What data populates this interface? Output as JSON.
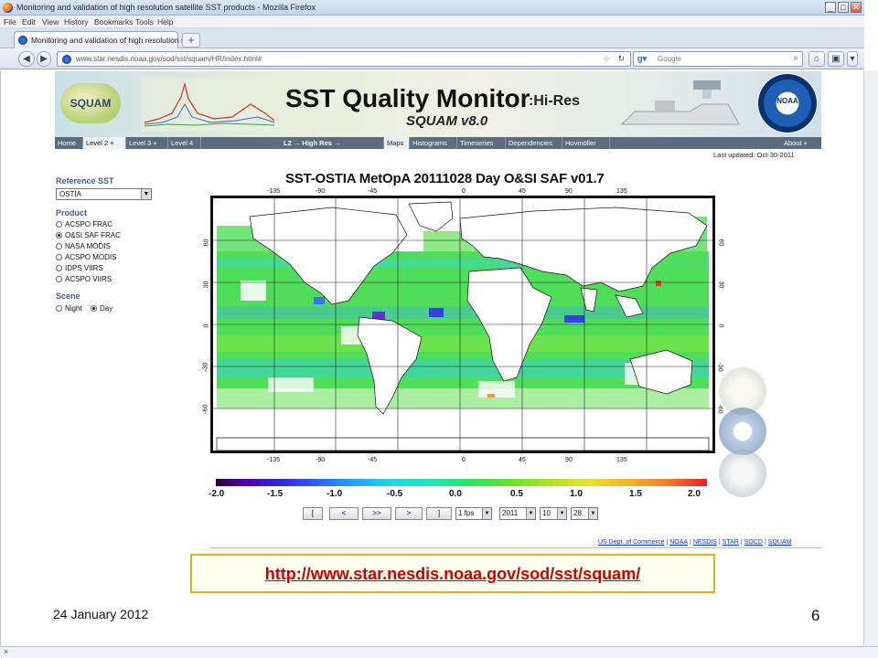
{
  "browser": {
    "title": "Monitoring and validation of high resolution satellite SST products - Mozilla Firefox",
    "menus": [
      "File",
      "Edit",
      "View",
      "History",
      "Bookmarks",
      "Tools",
      "Help"
    ],
    "tab_label": "Monitoring and validation of high resolution s...",
    "new_tab": "+",
    "url": "www.star.nesdis.noaa.gov/sod/sst/squam/HR/index.html#",
    "search_placeholder": "Google",
    "status_close": "×"
  },
  "banner": {
    "logo_text": "SQUAM",
    "title": "SST Quality Monitor",
    "subtitle": ":Hi-Res",
    "version": "SQUAM v8.0",
    "noaa": "NOAA"
  },
  "nav": {
    "items": [
      "Home",
      "Level 2 +",
      "Level 3 +",
      "Level 4",
      "L2 → High Res →",
      "Maps",
      "Histograms",
      "Timeseries",
      "Dependencies",
      "Hovmöller",
      "About +"
    ],
    "last_updated": "Last updated: Oct-30-2011"
  },
  "sidebar": {
    "reference_heading": "Reference SST",
    "reference_value": "OSTIA",
    "product_heading": "Product",
    "products": [
      {
        "label": "ACSPO FRAC",
        "selected": false
      },
      {
        "label": "O&SI SAF FRAC",
        "selected": true
      },
      {
        "label": "NASA MODIS",
        "selected": false
      },
      {
        "label": "ACSPO MODIS",
        "selected": false
      },
      {
        "label": "IDPS VIIRS",
        "selected": false
      },
      {
        "label": "ACSPO VIIRS",
        "selected": false
      }
    ],
    "scene_heading": "Scene",
    "scenes": [
      {
        "label": "Night",
        "selected": false
      },
      {
        "label": "Day",
        "selected": true
      }
    ]
  },
  "map": {
    "title": "SST-OSTIA  MetOpA  20111028  Day  O&SI SAF  v01.7",
    "lon_ticks": [
      "-135",
      "-90",
      "-45",
      "0",
      "45",
      "90",
      "135"
    ],
    "lat_ticks": [
      "60",
      "30",
      "0",
      "-30",
      "-60"
    ],
    "colorbar_labels": [
      "-2.0",
      "-1.5",
      "-1.0",
      "-0.5",
      "0.0",
      "0.5",
      "1.0",
      "1.5",
      "2.0"
    ],
    "colorbar_colors": [
      "#2a0033",
      "#3020d8",
      "#25a0ff",
      "#1fe7b2",
      "#63e62a",
      "#e6e22a",
      "#f37a2a",
      "#e8202a"
    ]
  },
  "controls": {
    "buttons": [
      "[",
      "<",
      ">>",
      ">",
      "]"
    ],
    "fps": "1 fps",
    "year": "2011",
    "month": "10",
    "day": "28"
  },
  "footer": {
    "links": [
      "US Dept. of Commerce",
      "NOAA",
      "NESDIS",
      "STAR",
      "SOCD",
      "SQUAM"
    ],
    "separator": "|"
  },
  "slide": {
    "url": "http://www.star.nesdis.noaa.gov/sod/sst/squam/",
    "date": "24 January 2012",
    "page_number": "6"
  }
}
